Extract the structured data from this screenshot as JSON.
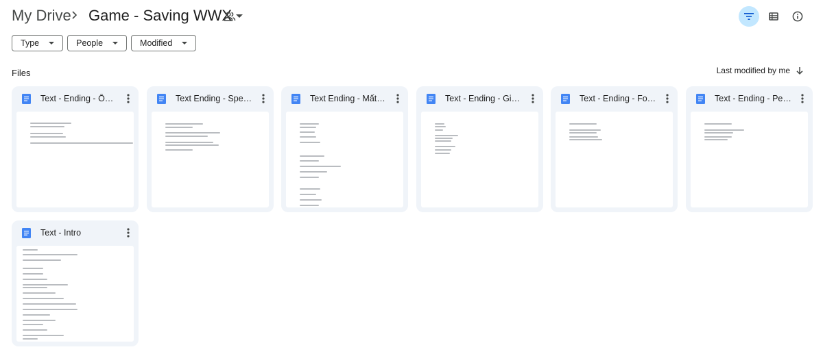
{
  "breadcrumb": {
    "root": "My Drive",
    "current": "Game - Saving WWX"
  },
  "icons": {
    "separator": "chevron-right-icon",
    "shared": "people-icon",
    "filter": "filter-list-icon",
    "layout": "grid-view-icon",
    "info": "info-icon",
    "sort": "arrow-down-icon",
    "doc": "google-docs-icon",
    "more": "more-vert-icon"
  },
  "colors": {
    "doc_icon": "#4285f4",
    "card_bg": "#f0f4f9",
    "active_button": "#c2e7ff"
  },
  "filters": [
    {
      "label": "Type"
    },
    {
      "label": "People"
    },
    {
      "label": "Modified"
    }
  ],
  "section": {
    "label": "Files",
    "sort_label": "Last modified by me"
  },
  "files": [
    {
      "name": "Text - Ending - Ôn ..."
    },
    {
      "name": "Text Ending - Speci..."
    },
    {
      "name": "Text Ending - Mất Tr..."
    },
    {
      "name": "Text - Ending - Gian..."
    },
    {
      "name": "Text - Ending - Fore..."
    },
    {
      "name": "Text - Ending - Perf..."
    },
    {
      "name": "Text - Intro"
    }
  ]
}
